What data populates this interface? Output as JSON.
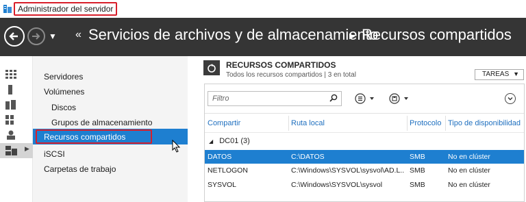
{
  "window": {
    "title": "Administrador del servidor"
  },
  "header": {
    "breadcrumb_root": "Servicios de archivos y de almacenamiento",
    "breadcrumb_current": "Recursos compartidos"
  },
  "rail": {
    "icons": [
      "dashboard-icon",
      "local-server-icon",
      "all-servers-icon",
      "server-group-icon",
      "ad-ds-icon",
      "file-storage-icon"
    ]
  },
  "nav": {
    "items": [
      {
        "label": "Servidores"
      },
      {
        "label": "Volúmenes"
      },
      {
        "label": "Discos"
      },
      {
        "label": "Grupos de almacenamiento"
      },
      {
        "label": "Recursos compartidos"
      },
      {
        "label": "iSCSI"
      },
      {
        "label": "Carpetas de trabajo"
      }
    ],
    "selected_index": 4
  },
  "section": {
    "title": "RECURSOS COMPARTIDOS",
    "subtitle": "Todos los recursos compartidos | 3 en total",
    "tasks_label": "TAREAS"
  },
  "filter": {
    "placeholder": "Filtro"
  },
  "table": {
    "columns": [
      "Compartir",
      "Ruta local",
      "Protocolo",
      "Tipo de disponibilidad"
    ],
    "group_label": "DC01 (3)",
    "rows": [
      {
        "share": "DATOS",
        "path": "C:\\DATOS",
        "protocol": "SMB",
        "availability": "No en clúster",
        "selected": true
      },
      {
        "share": "NETLOGON",
        "path": "C:\\Windows\\SYSVOL\\sysvol\\AD.L...",
        "protocol": "SMB",
        "availability": "No en clúster",
        "selected": false
      },
      {
        "share": "SYSVOL",
        "path": "C:\\Windows\\SYSVOL\\sysvol",
        "protocol": "SMB",
        "availability": "No en clúster",
        "selected": false
      }
    ]
  },
  "colors": {
    "accent": "#1e7fd0",
    "header_bg": "#353535",
    "highlight": "#d81e2a"
  }
}
